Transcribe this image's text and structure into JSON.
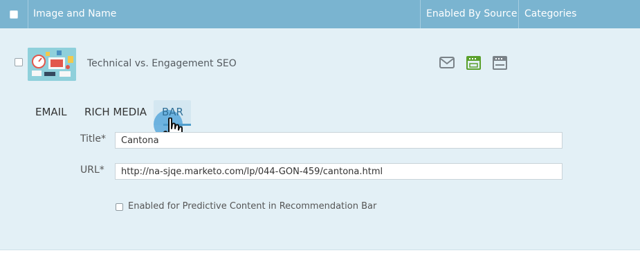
{
  "table": {
    "headers": {
      "image_and_name": "Image and Name",
      "enabled_by_source": "Enabled By Source",
      "categories": "Categories"
    }
  },
  "row": {
    "name": "Technical vs. Engagement SEO",
    "sources": [
      {
        "icon": "email-icon",
        "enabled": false,
        "color": "#7a8288"
      },
      {
        "icon": "rich-media-icon",
        "enabled": true,
        "color": "#5aa02c"
      },
      {
        "icon": "bar-icon",
        "enabled": false,
        "color": "#7a8288"
      }
    ]
  },
  "tabs": [
    {
      "label": "EMAIL",
      "active": false
    },
    {
      "label": "RICH MEDIA",
      "active": false
    },
    {
      "label": "BAR",
      "active": true
    }
  ],
  "form": {
    "title_label": "Title*",
    "title_value": "Cantona",
    "url_label": "URL*",
    "url_value": "http://na-sjqe.marketo.com/lp/044-GON-459/cantona.html",
    "predictive_label": "Enabled for Predictive Content in Recommendation Bar",
    "predictive_checked": false
  },
  "colors": {
    "header_bg": "#7ab4d0",
    "panel_bg": "#e3f0f6",
    "accent": "#4f9dcc"
  }
}
